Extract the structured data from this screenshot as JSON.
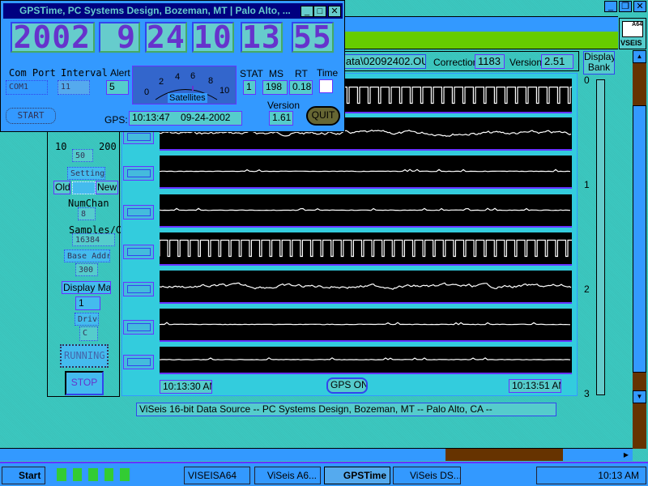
{
  "main_window": {
    "title": "",
    "controls": [
      "_",
      "❐",
      "✕"
    ]
  },
  "logo": {
    "text": "VSEIS",
    "badge": "A64"
  },
  "info": {
    "path": "lata\\02092402.OUT",
    "correction_label": "Correction",
    "correction": "1183",
    "version_label": "Version",
    "version": "2.51"
  },
  "display_bank": {
    "label_1": "Display",
    "label_2": "Bank",
    "ticks": [
      "0",
      "1",
      "2",
      "3"
    ],
    "value": 0
  },
  "left_panel": {
    "range_min": "10",
    "range_max": "200",
    "rate": "50",
    "settings": "Settings",
    "old": "Old",
    "new": "New",
    "numchan_label": "NumChan",
    "numchan": "8",
    "samples_label": "Samples/Ch",
    "samples": "16384",
    "base_label": "Base Addr",
    "base": "300",
    "display_mag_label": "Display Mag",
    "display_mag": "1",
    "drive_label": "Drive",
    "drive": "C",
    "running": "RUNNING",
    "stop": "STOP"
  },
  "plot": {
    "start_time": "10:13:30 AM",
    "end_time": "10:13:51 AM",
    "gps_button": "GPS ON",
    "channels": 8
  },
  "footer": "ViSeis 16-bit Data Source -- PC Systems Design, Bozeman, MT -- Palo Alto, CA --",
  "gps_window": {
    "title": "GPSTime, PC Systems Design,  Bozeman, MT | Palo Alto, ...",
    "controls": [
      "_",
      "□",
      "✕"
    ],
    "year": "2002",
    "month": "9",
    "day": "24",
    "hour": "10",
    "minute": "13",
    "second": "55",
    "com_port_label": "Com Port",
    "com_port": "COM1",
    "interval_label": "Interval",
    "interval": "11",
    "alert_label": "Alert",
    "alert": "5",
    "gauge": {
      "label": "Satellites",
      "ticks": [
        "0",
        "2",
        "4",
        "6",
        "8",
        "10"
      ],
      "value": 6
    },
    "stat_label": "STAT",
    "stat": "1",
    "ms_label": "MS",
    "ms": "198",
    "rt_label": "RT",
    "rt": "0.18",
    "time_label": "Time",
    "start": "START",
    "gps_label": "GPS:",
    "gps_value": "10:13:47    09-24-2002",
    "version_label": "Version",
    "version": "1.61",
    "quit": "QUIT"
  },
  "taskbar": {
    "start": "Start",
    "tasks": [
      "VISEISA64",
      "ViSeis A6...",
      "GPSTime",
      "ViSeis DS..."
    ],
    "active": "GPSTime",
    "clock": "10:13 AM"
  },
  "colors": {
    "blue": "#3399ff",
    "green": "#66cc00",
    "teal": "#3cc8c0",
    "navy": "#000080",
    "brown": "#663300",
    "purple": "#6633cc"
  }
}
